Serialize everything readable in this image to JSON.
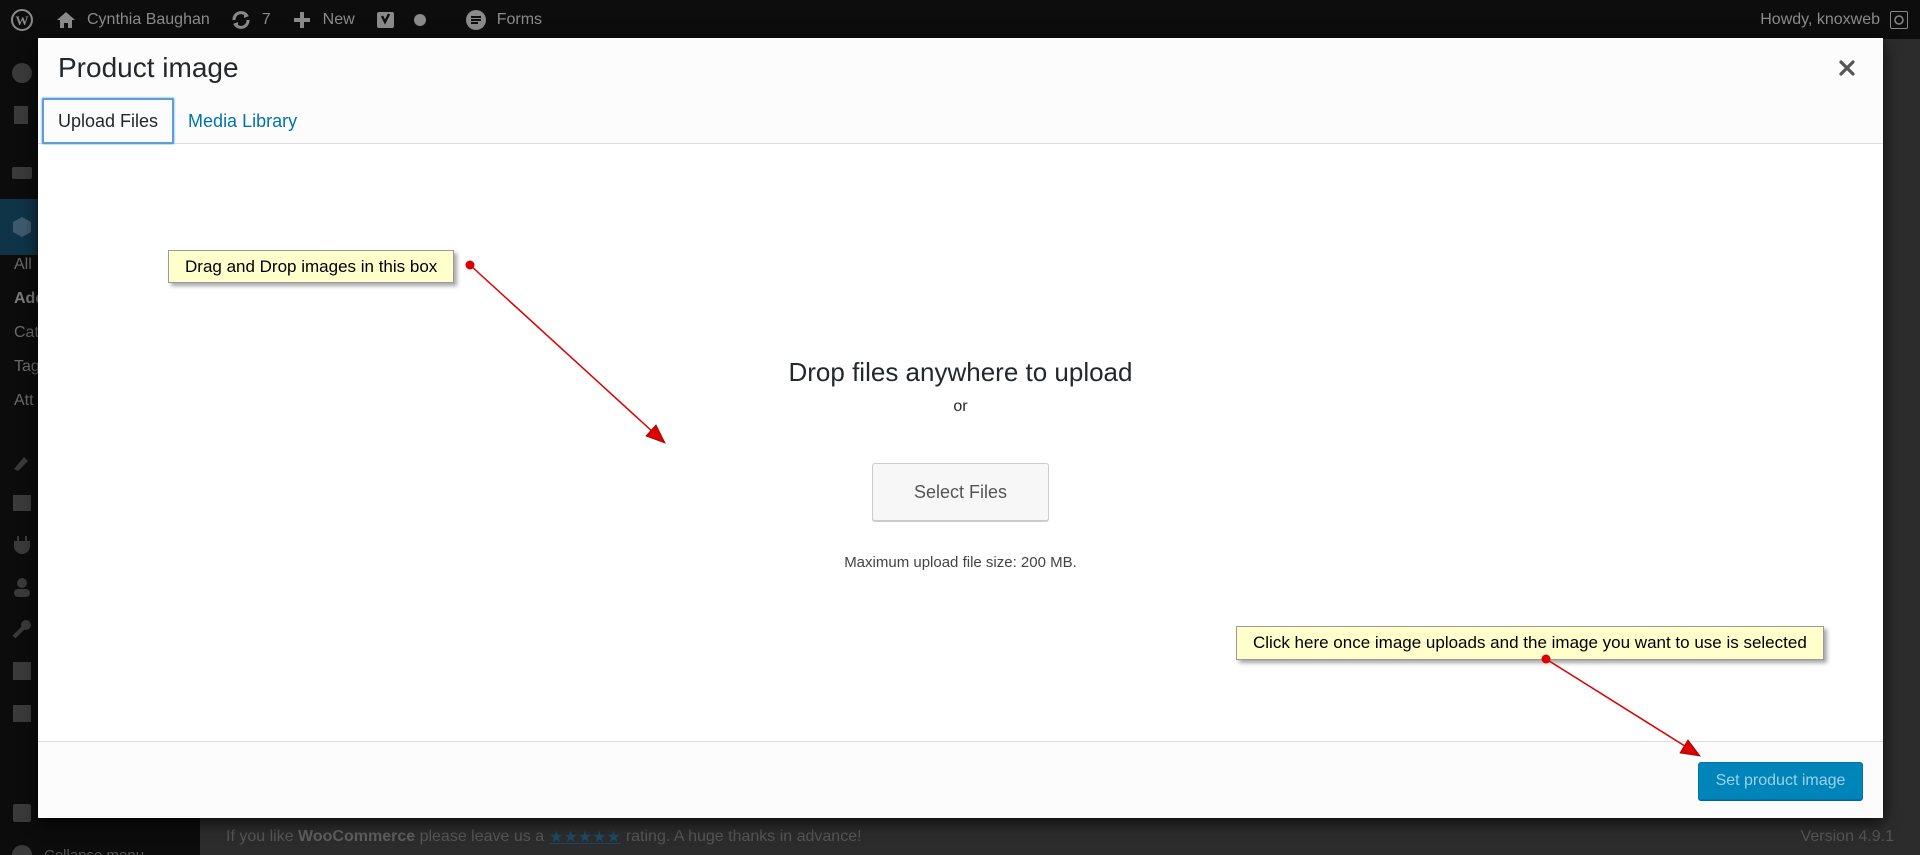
{
  "admin_bar": {
    "site_name": "Cynthia Baughan",
    "updates_count": "7",
    "new_label": "New",
    "forms_label": "Forms",
    "greeting": "Howdy, knoxweb"
  },
  "sidebar": {
    "items": [
      "All",
      "Add",
      "Cat",
      "Tag",
      "Att"
    ],
    "collapse_label": "Collapse menu"
  },
  "footer": {
    "text_prefix": "If you like",
    "brand": "WooCommerce",
    "text_mid": "please leave us a",
    "stars": "★★★★★",
    "text_suffix": "rating. A huge thanks in advance!",
    "version": "Version 4.9.1"
  },
  "modal": {
    "title": "Product image",
    "tabs": [
      {
        "label": "Upload Files",
        "active": true
      },
      {
        "label": "Media Library",
        "active": false
      }
    ],
    "drop_title": "Drop files anywhere to upload",
    "or_text": "or",
    "select_files_label": "Select Files",
    "max_size_text": "Maximum upload file size: 200 MB.",
    "set_button_label": "Set product image"
  },
  "callouts": {
    "drag_drop": "Drag and Drop images in this box",
    "click_here": "Click here once image uploads and the image you want to use is selected"
  },
  "colors": {
    "primary_blue": "#0085ba",
    "link_blue": "#0073aa",
    "callout_bg": "#ffffcc",
    "arrow_red": "#dd0000"
  }
}
